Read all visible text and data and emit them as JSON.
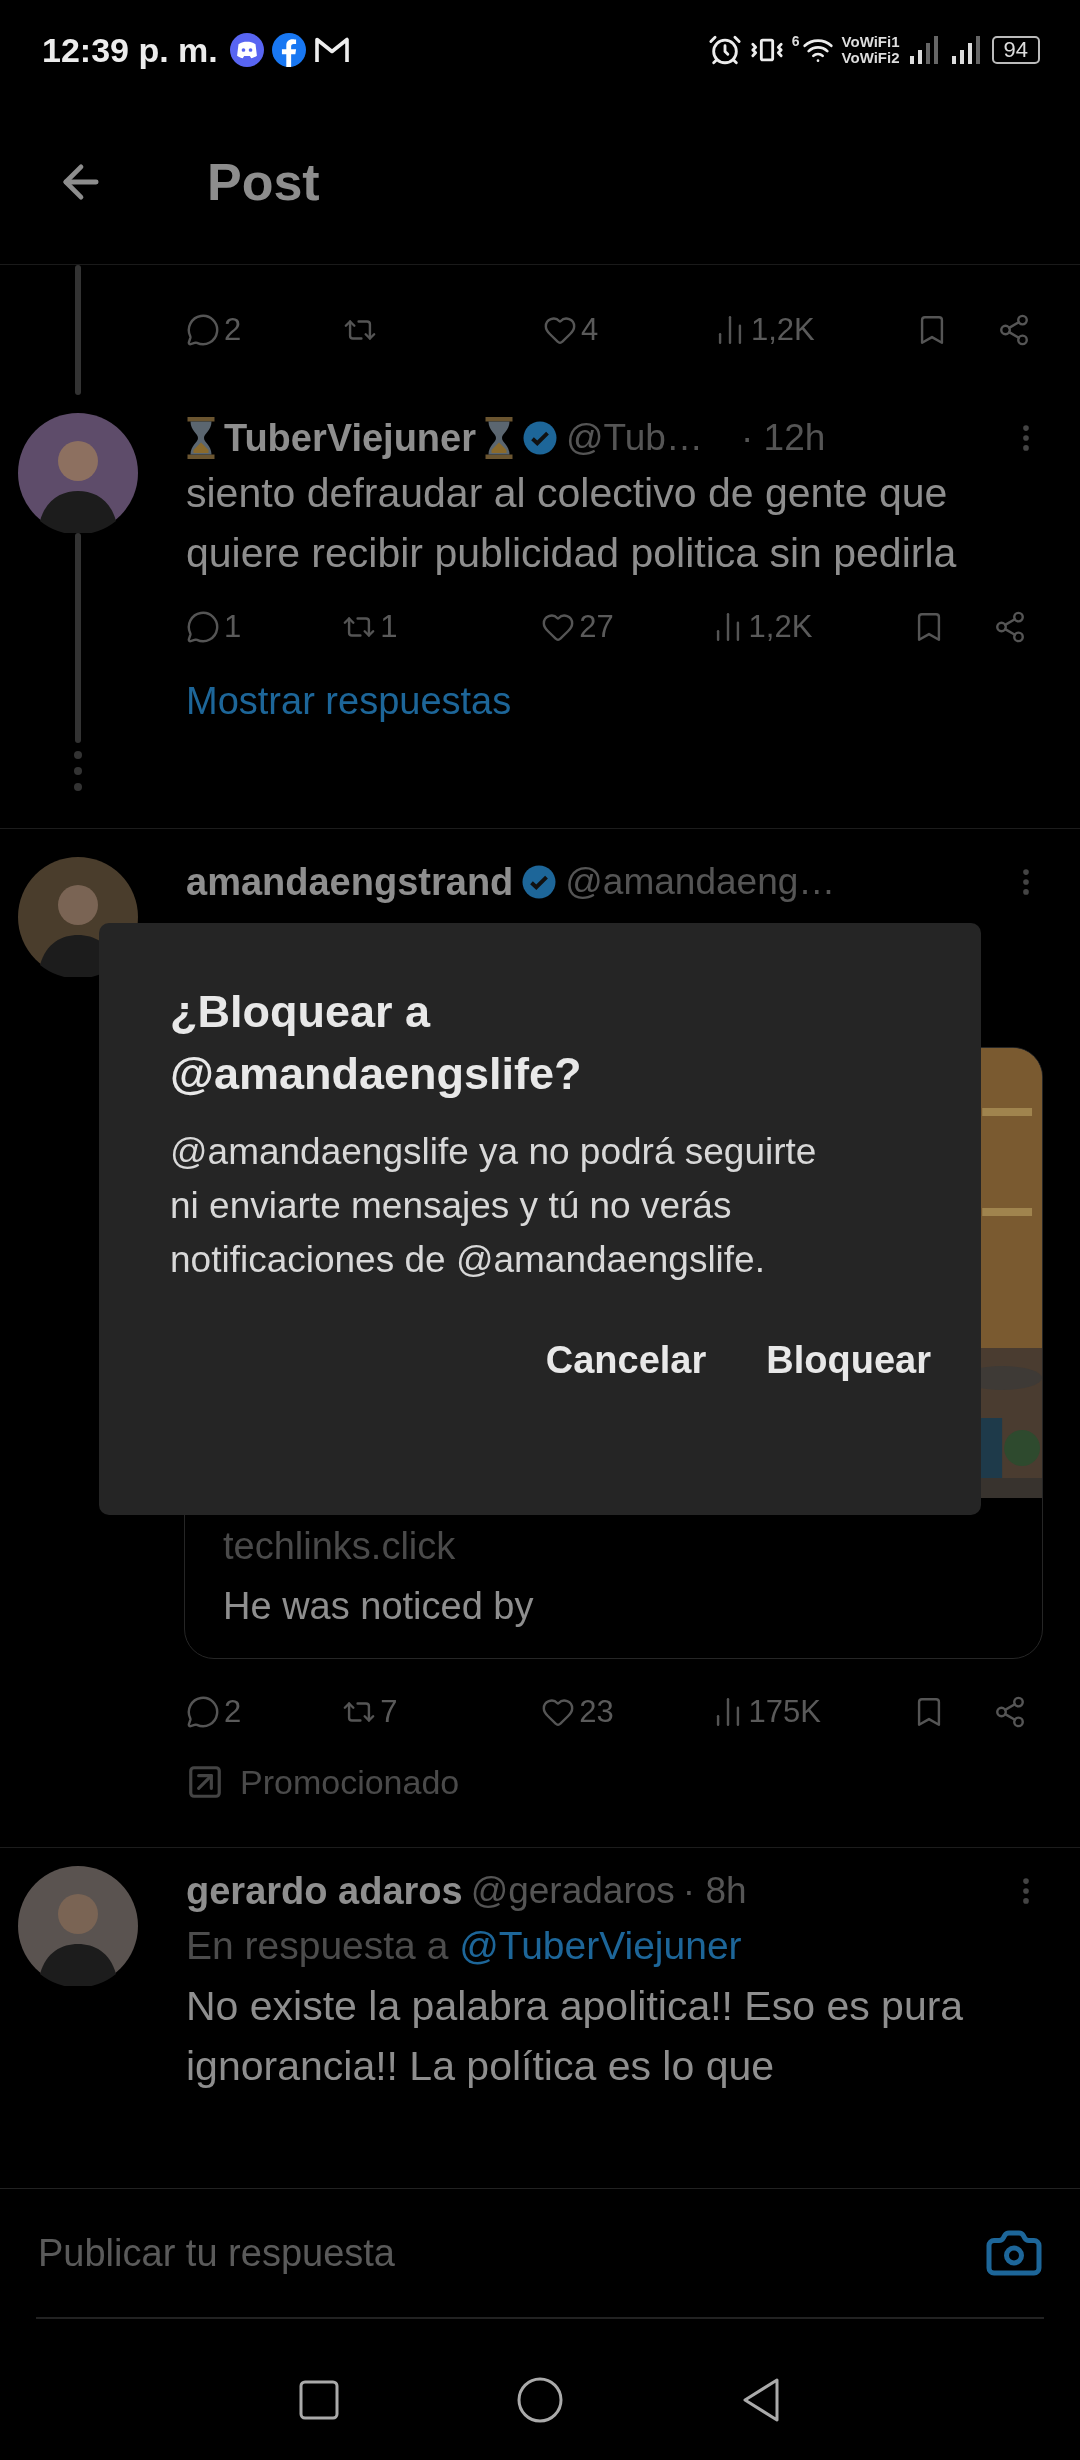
{
  "status_bar": {
    "time": "12:39 p. m.",
    "wifi_badge": "6",
    "network_1": "VoWiFi1",
    "network_2": "VoWiFi2",
    "battery": "94"
  },
  "header": {
    "title": "Post"
  },
  "top_actions": {
    "reply": "2",
    "like": "4",
    "views": "1,2K"
  },
  "posts": [
    {
      "kind": "thread",
      "name": "TuberViejuner",
      "handle": "@Tub…",
      "time": "· 12h",
      "verified": true,
      "text": "siento defraudar al colectivo de gente que quiere recibir publicidad politica sin pedirla",
      "actions": {
        "reply": "1",
        "repost": "1",
        "like": "27",
        "views": "1,2K"
      },
      "show_replies": "Mostrar respuestas"
    },
    {
      "kind": "ad",
      "name": "amandaengstrand",
      "handle": "@amandaeng…",
      "verified": true,
      "card": {
        "domain": "techlinks.click",
        "title": "He was noticed by"
      },
      "actions": {
        "reply": "2",
        "repost": "7",
        "like": "23",
        "views": "175K"
      },
      "promoted": "Promocionado"
    },
    {
      "kind": "reply",
      "name": "gerardo adaros",
      "handle": "@geradaros",
      "time": "· 8h",
      "verified": false,
      "reply_prefix": "En respuesta a",
      "reply_to": "@TuberViejuner",
      "text": "No existe la palabra apolitica!! Eso es pura ignorancia!! La política es lo que"
    }
  ],
  "dialog": {
    "title": "¿Bloquear a @amandaengslife?",
    "body": "@amandaengslife ya no podrá seguirte ni enviarte mensajes y tú no verás notificaciones de @amandaengslife.",
    "buttons": [
      "Cancelar",
      "Bloquear"
    ]
  },
  "reply_bar": {
    "placeholder": "Publicar tu respuesta"
  }
}
